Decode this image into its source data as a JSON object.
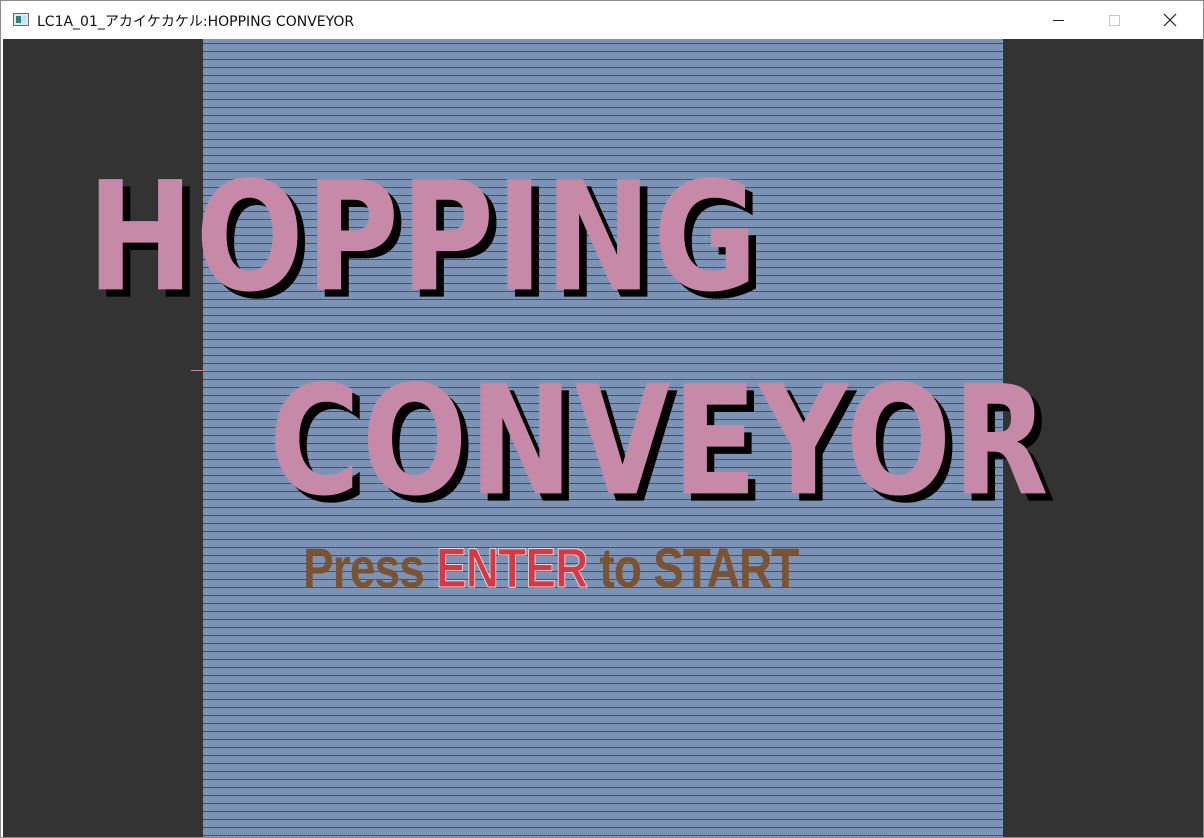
{
  "window": {
    "title": "LC1A_01_アカイケカケル:HOPPING CONVEYOR",
    "app_icon": "window-app-icon",
    "controls": [
      "minimize",
      "maximize",
      "close"
    ]
  },
  "game": {
    "logo_line1": "HOPPING",
    "logo_line2": "CONVEYOR",
    "prompt": {
      "press": "Press",
      "enter": "ENTER",
      "to": "to",
      "start": "START"
    }
  },
  "colors": {
    "sidebar": "#333333",
    "playfield": "#7d93b5",
    "logo": "#c68aa8",
    "logo_shadow": "#000000",
    "prompt_text": "#7a5432",
    "prompt_enter": "#d43a46"
  }
}
